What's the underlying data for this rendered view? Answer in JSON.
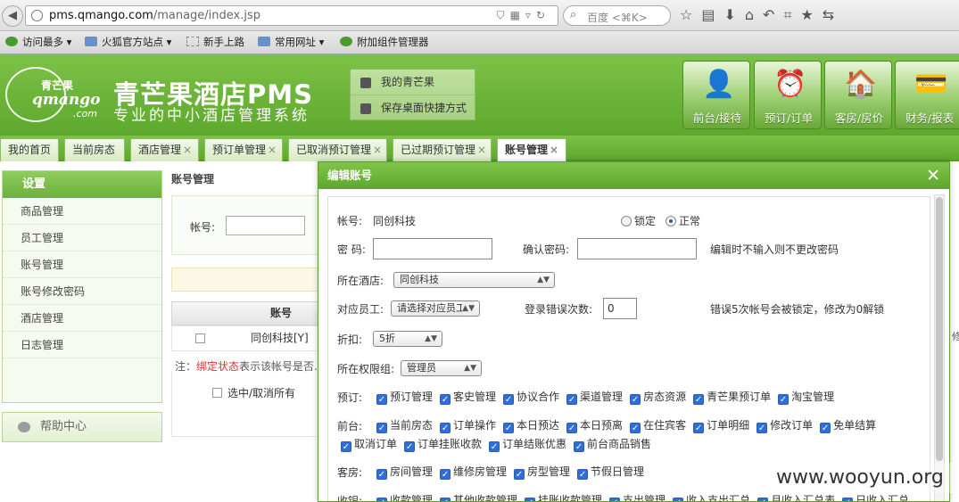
{
  "browser": {
    "url_host": "pms.qmango.com",
    "url_path": "/manage/index.jsp",
    "search_placeholder": "百度 <⌘K>"
  },
  "bookmarks": [
    {
      "label": "访问最多",
      "icon": "gear-icon"
    },
    {
      "label": "火狐官方站点",
      "icon": "folder-icon"
    },
    {
      "label": "新手上路",
      "icon": "page-icon"
    },
    {
      "label": "常用网址",
      "icon": "folder-icon"
    },
    {
      "label": "附加组件管理器",
      "icon": "puzzle-icon"
    }
  ],
  "header": {
    "logo_cn": "青芒果",
    "logo_en": "qmango",
    "logo_com": ".com",
    "title": "青芒果酒店PMS",
    "slogan": "专业的中小酒店管理系统",
    "quick_links": [
      "我的青芒果",
      "保存桌面快捷方式"
    ],
    "big_buttons": [
      {
        "label": "前台/接待",
        "icon": "reception-icon"
      },
      {
        "label": "预订/订单",
        "icon": "alarm-clock-icon"
      },
      {
        "label": "客房/房价",
        "icon": "house-icon"
      },
      {
        "label": "财务/报表",
        "icon": "finance-card-icon"
      }
    ]
  },
  "tabs": [
    {
      "label": "我的首页",
      "closable": false
    },
    {
      "label": "当前房态",
      "closable": false
    },
    {
      "label": "酒店管理",
      "closable": true
    },
    {
      "label": "预订单管理",
      "closable": true
    },
    {
      "label": "已取消预订管理",
      "closable": true
    },
    {
      "label": "已过期预订管理",
      "closable": true
    },
    {
      "label": "账号管理",
      "closable": true,
      "active": true
    }
  ],
  "sidebar": {
    "title": "设置",
    "items": [
      "商品管理",
      "员工管理",
      "账号管理",
      "账号修改密码",
      "酒店管理",
      "日志管理"
    ],
    "help": "帮助中心"
  },
  "main": {
    "title": "账号管理",
    "search_label": "帐号:",
    "table_header": "账号",
    "row_account": "同创科技[Y]",
    "note_prefix": "注：",
    "note_red": "绑定状态",
    "note_rest": "表示该帐号是否...",
    "select_all": "选中/取消所有",
    "right_edge": "修"
  },
  "modal": {
    "title": "编辑账号",
    "account_label": "帐号:",
    "account_value": "同创科技",
    "lock_label": "锁定",
    "normal_label": "正常",
    "password_label": "密  码:",
    "confirm_label": "确认密码:",
    "password_hint": "编辑时不输入则不更改密码",
    "hotel_label": "所在酒店:",
    "hotel_value": "同创科技",
    "staff_label": "对应员工:",
    "staff_value": "请选择对应员工",
    "login_error_label": "登录错误次数:",
    "login_error_value": "0",
    "login_error_hint": "错误5次帐号会被锁定，修改为0解锁",
    "discount_label": "折扣:",
    "discount_value": "5折",
    "role_label": "所在权限组:",
    "role_value": "管理员",
    "perm_booking_label": "预订:",
    "perm_booking": [
      "预订管理",
      "客史管理",
      "协议合作",
      "渠道管理",
      "房态资源",
      "青芒果预订单",
      "淘宝管理"
    ],
    "perm_front_label": "前台:",
    "perm_front_1": [
      "当前房态",
      "订单操作",
      "本日预达",
      "本日预离",
      "在住宾客",
      "订单明细",
      "修改订单",
      "免单结算"
    ],
    "perm_front_2": [
      "取消订单",
      "订单挂账收款",
      "订单结账优惠",
      "前台商品销售"
    ],
    "perm_room_label": "客房:",
    "perm_room": [
      "房间管理",
      "维修房管理",
      "房型管理",
      "节假日管理"
    ],
    "perm_cash_label": "收银:",
    "perm_cash": [
      "收款管理",
      "其他收款管理",
      "挂账收款管理",
      "支出管理",
      "收入支出汇总",
      "月收入汇总表",
      "日收入汇总"
    ]
  },
  "watermark": "www.wooyun.org"
}
